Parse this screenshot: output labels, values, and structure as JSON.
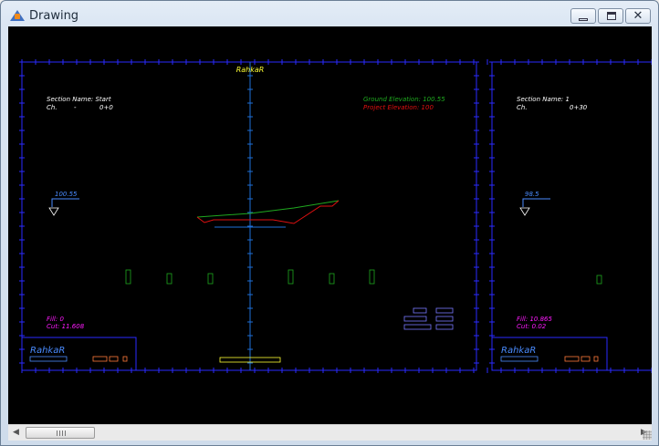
{
  "window": {
    "title": "Drawing"
  },
  "brand": "RahkaR",
  "sections": [
    {
      "name_label": "Section Name: Start",
      "ch_label": "Ch.",
      "ch_sep": "-",
      "ch_value": "0+0",
      "ground_elevation": "Ground Elevation: 100.55",
      "project_elevation": "Project Elevation: 100",
      "level_marker": "100.55",
      "fill": "Fill: 0",
      "cut": "Cut: 11.608"
    },
    {
      "name_label": "Section Name: 1",
      "ch_label": "Ch.",
      "ch_value": "0+30",
      "level_marker": "98.5",
      "fill": "Fill: 10.865",
      "cut": "Cut: 0.02"
    }
  ],
  "colors": {
    "canvas": "#000000",
    "frame": "#2a2aff",
    "axis": "#1e6fd8",
    "text": "#ffffff",
    "ground": "#1fa81f",
    "project": "#e01010",
    "fill_cut": "#ff1aff",
    "brand": "#ffff33",
    "marker": "#4a8cff",
    "table": "#7777ff",
    "legend_orange": "#ff7a3a"
  }
}
